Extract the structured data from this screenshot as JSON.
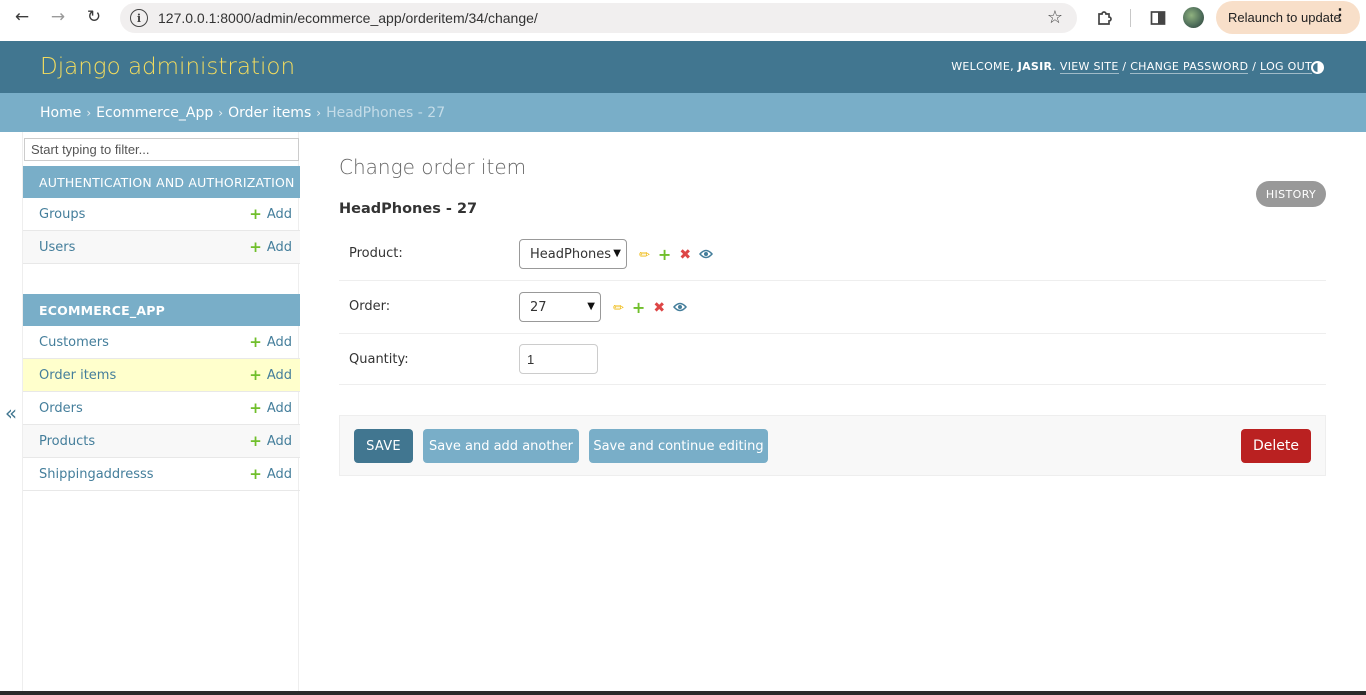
{
  "browser": {
    "url": "127.0.0.1:8000/admin/ecommerce_app/orderitem/34/change/",
    "relaunch_label": "Relaunch to update"
  },
  "header": {
    "branding": "Django administration",
    "welcome": "WELCOME,",
    "username": "JASIR",
    "view_site": "VIEW SITE",
    "change_password": "CHANGE PASSWORD",
    "log_out": "LOG OUT"
  },
  "breadcrumbs": {
    "home": "Home",
    "app": "Ecommerce_App",
    "model": "Order items",
    "current": "HeadPhones - 27"
  },
  "sidebar": {
    "toggle": "«",
    "filter_placeholder": "Start typing to filter...",
    "add_label": "Add",
    "modules": [
      {
        "caption": "AUTHENTICATION AND AUTHORIZATION",
        "items": [
          {
            "label": "Groups"
          },
          {
            "label": "Users"
          }
        ]
      },
      {
        "caption": "ECOMMERCE_APP",
        "items": [
          {
            "label": "Customers"
          },
          {
            "label": "Order items"
          },
          {
            "label": "Orders"
          },
          {
            "label": "Products"
          },
          {
            "label": "Shippingaddresss"
          }
        ]
      }
    ]
  },
  "content": {
    "title": "Change order item",
    "history": "HISTORY",
    "object_title": "HeadPhones - 27",
    "fields": {
      "product": {
        "label": "Product:",
        "value": "HeadPhones"
      },
      "order": {
        "label": "Order:",
        "value": "27"
      },
      "quantity": {
        "label": "Quantity:",
        "value": "1"
      }
    }
  },
  "submit": {
    "save": "SAVE",
    "save_add_another": "Save and add another",
    "save_continue": "Save and continue editing",
    "delete": "Delete"
  },
  "colors": {
    "header_bg": "#417690",
    "branding": "#f5dd5d",
    "breadcrumbs_bg": "#79aec8",
    "link": "#447e9b",
    "add_green": "#70bf2b",
    "delete_red": "#ba2121",
    "current_row": "#ffffcc"
  },
  "icons": {
    "back": "arrow-left-icon",
    "forward": "arrow-right-icon",
    "reload": "reload-icon",
    "site_info": "info-icon",
    "bookmark": "star-icon",
    "extensions": "puzzle-icon",
    "side_panel": "side-panel-icon",
    "menu": "kebab-menu-icon",
    "theme": "theme-toggle-icon",
    "edit": "pencil-icon",
    "add": "plus-icon",
    "delete": "x-icon",
    "view": "eye-icon"
  }
}
